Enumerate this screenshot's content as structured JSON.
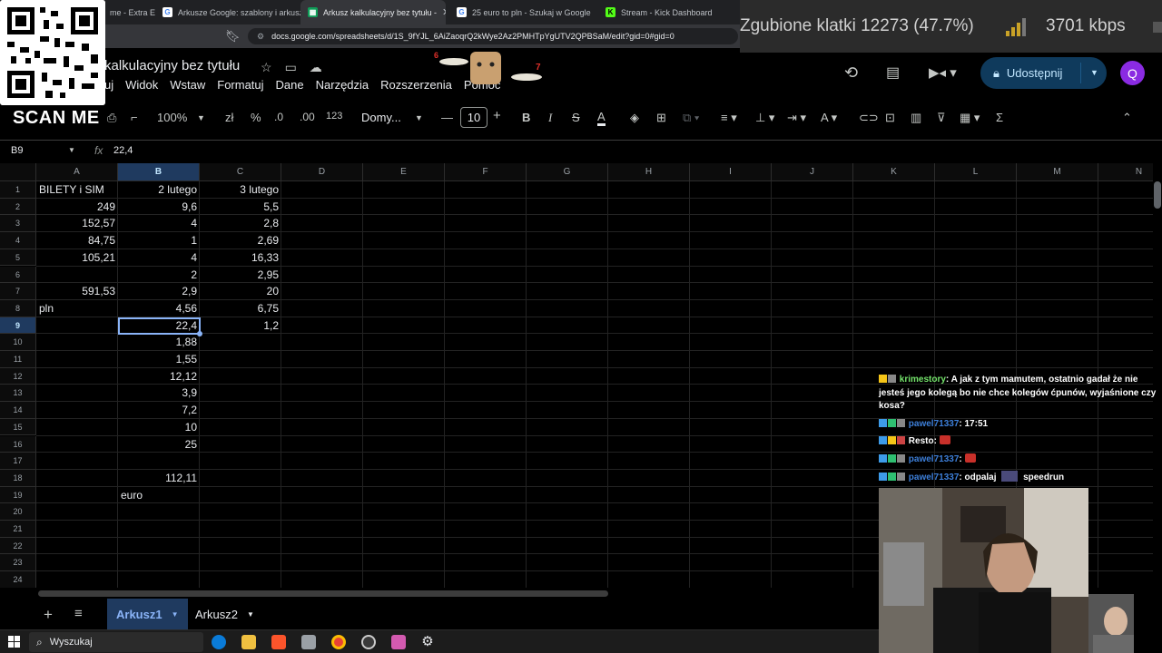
{
  "browser": {
    "tabs": [
      {
        "label": "me - Extra E",
        "fav": "",
        "color": "#555"
      },
      {
        "label": "Arkusze Google: szablony i arkusze",
        "fav": "G",
        "color": "#4285f4"
      },
      {
        "label": "Arkusz kalkulacyjny bez tytułu -",
        "fav": "▦",
        "color": "#0f9d58"
      },
      {
        "label": "25 euro to pln - Szukaj w Google",
        "fav": "G",
        "color": "#4285f4"
      },
      {
        "label": "Stream - Kick Dashboard",
        "fav": "K",
        "color": "#53fc18"
      }
    ],
    "url": "docs.google.com/spreadsheets/d/1S_9fYJL_6AiZaoqrQ2kWye2Az2PMHTpYgUTV2QPBSaM/edit?gid=0#gid=0"
  },
  "stream_stats": {
    "dropped": "Zgubione klatki 12273 (47.7%)",
    "bitrate": "3701 kbps"
  },
  "overlay": {
    "scan_me": "SCAN ME"
  },
  "sheets": {
    "doc_title": "kalkulacyjny bez tytułu",
    "menu": [
      "uj",
      "Widok",
      "Wstaw",
      "Formatuj",
      "Dane",
      "Narzędzia",
      "Rozszerzenia",
      "Pomoc"
    ],
    "share_label": "Udostępnij",
    "avatar_letter": "Q",
    "toolbar": {
      "zoom": "100%",
      "currency": "zł",
      "percent": "%",
      "dec_minus": ".0",
      "dec_plus": ".00",
      "number_format": "123",
      "font": "Domy...",
      "font_size": "10"
    },
    "namebox": "B9",
    "formula_value": "22,4",
    "columns": [
      "A",
      "B",
      "C",
      "D",
      "E",
      "F",
      "G",
      "H",
      "I",
      "J",
      "K",
      "L",
      "M",
      "N"
    ],
    "selected_col": "B",
    "selected_row": 9,
    "rows": [
      {
        "n": 1,
        "a": "BILETY i SIM",
        "b": "2 lutego",
        "c": "3 lutego"
      },
      {
        "n": 2,
        "a": "249",
        "b": "9,6",
        "c": "5,5"
      },
      {
        "n": 3,
        "a": "152,57",
        "b": "4",
        "c": "2,8"
      },
      {
        "n": 4,
        "a": "84,75",
        "b": "1",
        "c": "2,69"
      },
      {
        "n": 5,
        "a": "105,21",
        "b": "4",
        "c": "16,33"
      },
      {
        "n": 6,
        "a": "",
        "b": "2",
        "c": "2,95"
      },
      {
        "n": 7,
        "a": "591,53",
        "b": "2,9",
        "c": "20"
      },
      {
        "n": 8,
        "a": "pln",
        "b": "4,56",
        "c": "6,75"
      },
      {
        "n": 9,
        "a": "",
        "b": "22,4",
        "c": "1,2"
      },
      {
        "n": 10,
        "a": "",
        "b": "1,88",
        "c": ""
      },
      {
        "n": 11,
        "a": "",
        "b": "1,55",
        "c": ""
      },
      {
        "n": 12,
        "a": "",
        "b": "12,12",
        "c": ""
      },
      {
        "n": 13,
        "a": "",
        "b": "3,9",
        "c": ""
      },
      {
        "n": 14,
        "a": "",
        "b": "7,2",
        "c": ""
      },
      {
        "n": 15,
        "a": "",
        "b": "10",
        "c": ""
      },
      {
        "n": 16,
        "a": "",
        "b": "25",
        "c": ""
      },
      {
        "n": 17,
        "a": "",
        "b": "",
        "c": ""
      },
      {
        "n": 18,
        "a": "",
        "b": "112,11",
        "c": ""
      },
      {
        "n": 19,
        "a": "",
        "b": "euro",
        "c": ""
      },
      {
        "n": 20,
        "a": "",
        "b": "",
        "c": ""
      },
      {
        "n": 21,
        "a": "",
        "b": "",
        "c": ""
      },
      {
        "n": 22,
        "a": "",
        "b": "",
        "c": ""
      },
      {
        "n": 23,
        "a": "",
        "b": "",
        "c": ""
      },
      {
        "n": 24,
        "a": "",
        "b": "",
        "c": ""
      }
    ],
    "sheet_tabs": [
      "Arkusz1",
      "Arkusz2"
    ]
  },
  "chat": [
    {
      "user": "krimestory",
      "color": "green",
      "text": "A jak z tym mamutem, ostatnio gadał że nie jesteś jego kolegą bo nie chce kolegów ćpunów, wyjaśnione czy kosa?"
    },
    {
      "user": "pawel71337",
      "color": "blue",
      "text": "17:51"
    },
    {
      "user": "Resto",
      "color": "white",
      "text": ""
    },
    {
      "user": "pawel71337",
      "color": "blue",
      "text": ""
    },
    {
      "user": "pawel71337",
      "color": "blue",
      "text": "odpalaj",
      "text2": "speedrun"
    }
  ],
  "taskbar": {
    "search_placeholder": "Wyszukaj"
  }
}
